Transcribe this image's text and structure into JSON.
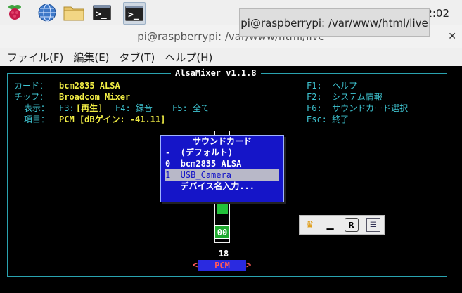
{
  "taskbar": {
    "clock": "2:02",
    "items": [
      "raspberry-icon",
      "globe-icon",
      "folder-icon",
      "terminal-icon",
      "terminal-icon-active"
    ]
  },
  "tooltip": {
    "text": "pi@raspberrypi: /var/www/html/live"
  },
  "window": {
    "title": "pi@raspberrypi: /var/www/html/live"
  },
  "menubar": {
    "file": "ファイル(F)",
    "edit": "編集(E)",
    "tabs": "タブ(T)",
    "help": "ヘルプ(H)"
  },
  "alsamixer": {
    "title": "AlsaMixer v1.1.8",
    "card_label": "カード：",
    "card_value": "bcm2835 ALSA",
    "chip_label": "チップ：",
    "chip_value": "Broadcom Mixer",
    "view_label": "表示：",
    "view_f3": "F3:",
    "view_play": "[再生]",
    "view_f4": "F4: 録音",
    "view_f5": "F5: 全て",
    "item_label": "項目：",
    "item_value": "PCM [dBゲイン: -41.11]",
    "help_f1": "F1:  ヘルプ",
    "help_f2": "F2:  システム情報",
    "help_f6": "F6:  サウンドカード選択",
    "help_esc": "Esc: 終了",
    "volume_value": "18",
    "mute_label": "00",
    "control_name": "PCM",
    "arrow_left": "<",
    "arrow_right": ">"
  },
  "popup": {
    "title": "サウンドカード",
    "rows": [
      "-  (デフォルト)",
      "0  bcm2835 ALSA",
      "1  USB_Camera",
      "   デバイス名入力..."
    ],
    "selected_index": 2
  },
  "colors": {
    "cyan": "#3ec4d1",
    "yellow": "#f2ee45",
    "popup_bg": "#1515c8",
    "green": "#22c13a"
  }
}
